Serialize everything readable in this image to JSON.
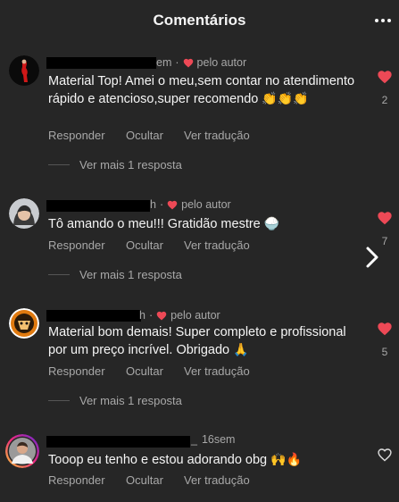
{
  "header": {
    "title": "Comentários"
  },
  "comments": [
    {
      "meta_suffix": "em",
      "author_label": "pelo autor",
      "text": "Material Top! Amei o meu,sem contar no atendimento rápido e atencioso,super recomendo",
      "emoji": "👏👏👏",
      "like_count": "2",
      "liked": true,
      "reply": "Responder",
      "hide": "Ocultar",
      "translate": "Ver tradução",
      "more_replies": "Ver mais 1 resposta"
    },
    {
      "meta_suffix": "h",
      "author_label": "pelo autor",
      "text": "Tô amando o meu!!! Gratidão mestre",
      "emoji": "🍚",
      "like_count": "7",
      "liked": true,
      "reply": "Responder",
      "hide": "Ocultar",
      "translate": "Ver tradução",
      "more_replies": "Ver mais 1 resposta"
    },
    {
      "meta_suffix": "h",
      "author_label": "pelo autor",
      "text": "Material bom demais! Super completo e profissional por um preço incrível. Obrigado",
      "emoji": "🙏",
      "like_count": "5",
      "liked": true,
      "reply": "Responder",
      "hide": "Ocultar",
      "translate": "Ver tradução",
      "more_replies": "Ver mais 1 resposta"
    },
    {
      "meta_suffix": "_",
      "time": "16sem",
      "text": "Tooop eu tenho e estou adorando obg",
      "emoji": "🙌🔥",
      "liked": false,
      "reply": "Responder",
      "hide": "Ocultar",
      "translate": "Ver tradução"
    }
  ],
  "colors": {
    "background": "#262626",
    "heart": "#ed4956",
    "muted": "#a8a8a8"
  }
}
